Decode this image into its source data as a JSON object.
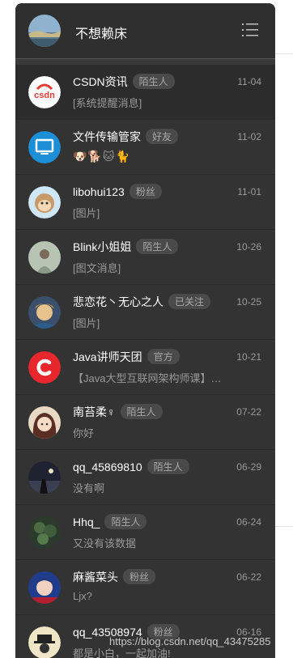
{
  "header": {
    "title": "不想赖床",
    "menu_icon": "list-menu-icon"
  },
  "conversations": [
    {
      "name": "CSDN资讯",
      "badge": "陌生人",
      "time": "11-04",
      "message": "[系统提醒消息]",
      "avatar_icon": "csdn-logo-icon"
    },
    {
      "name": "文件传输管家",
      "badge": "好友",
      "time": "11-02",
      "message": "🐶🐕🐱🐈",
      "avatar_icon": "monitor-icon"
    },
    {
      "name": "libohui123",
      "badge": "粉丝",
      "time": "11-01",
      "message": "[图片]",
      "avatar_icon": "monkey-avatar-icon"
    },
    {
      "name": "Blink小姐姐",
      "badge": "陌生人",
      "time": "10-26",
      "message": "[图文消息]",
      "avatar_icon": "person-photo-icon"
    },
    {
      "name": "悲恋花丶无心之人",
      "badge": "已关注",
      "time": "10-25",
      "message": "[图片]",
      "avatar_icon": "anime-avatar-icon"
    },
    {
      "name": "Java讲师天团",
      "badge": "官方",
      "time": "10-21",
      "message": "【Java大型互联网架构师课】…",
      "avatar_icon": "red-c-logo-icon"
    },
    {
      "name": "南苔柔♀",
      "badge": "陌生人",
      "time": "07-22",
      "message": "你好",
      "avatar_icon": "anime-girl-avatar-icon"
    },
    {
      "name": "qq_45869810",
      "badge": "陌生人",
      "time": "06-29",
      "message": "没有啊",
      "avatar_icon": "night-photo-icon"
    },
    {
      "name": "Hhq_",
      "badge": "陌生人",
      "time": "06-24",
      "message": "又没有该数据",
      "avatar_icon": "plant-photo-icon"
    },
    {
      "name": "麻酱菜头",
      "badge": "粉丝",
      "time": "06-22",
      "message": "Ljx?",
      "avatar_icon": "blue-anime-avatar-icon"
    },
    {
      "name": "qq_43508974",
      "badge": "粉丝",
      "time": "06-16",
      "message": "都是小白，一起加油!",
      "avatar_icon": "hat-man-avatar-icon"
    }
  ],
  "watermark": "https://blog.csdn.net/qq_43475285",
  "colors": {
    "panel": "#333333",
    "badge_bg": "#4a4a4a",
    "muted_text": "#9a9a9a",
    "csdn_red": "#e33e33",
    "java_red": "#e8262d",
    "monitor_blue": "#1c8fd6"
  }
}
